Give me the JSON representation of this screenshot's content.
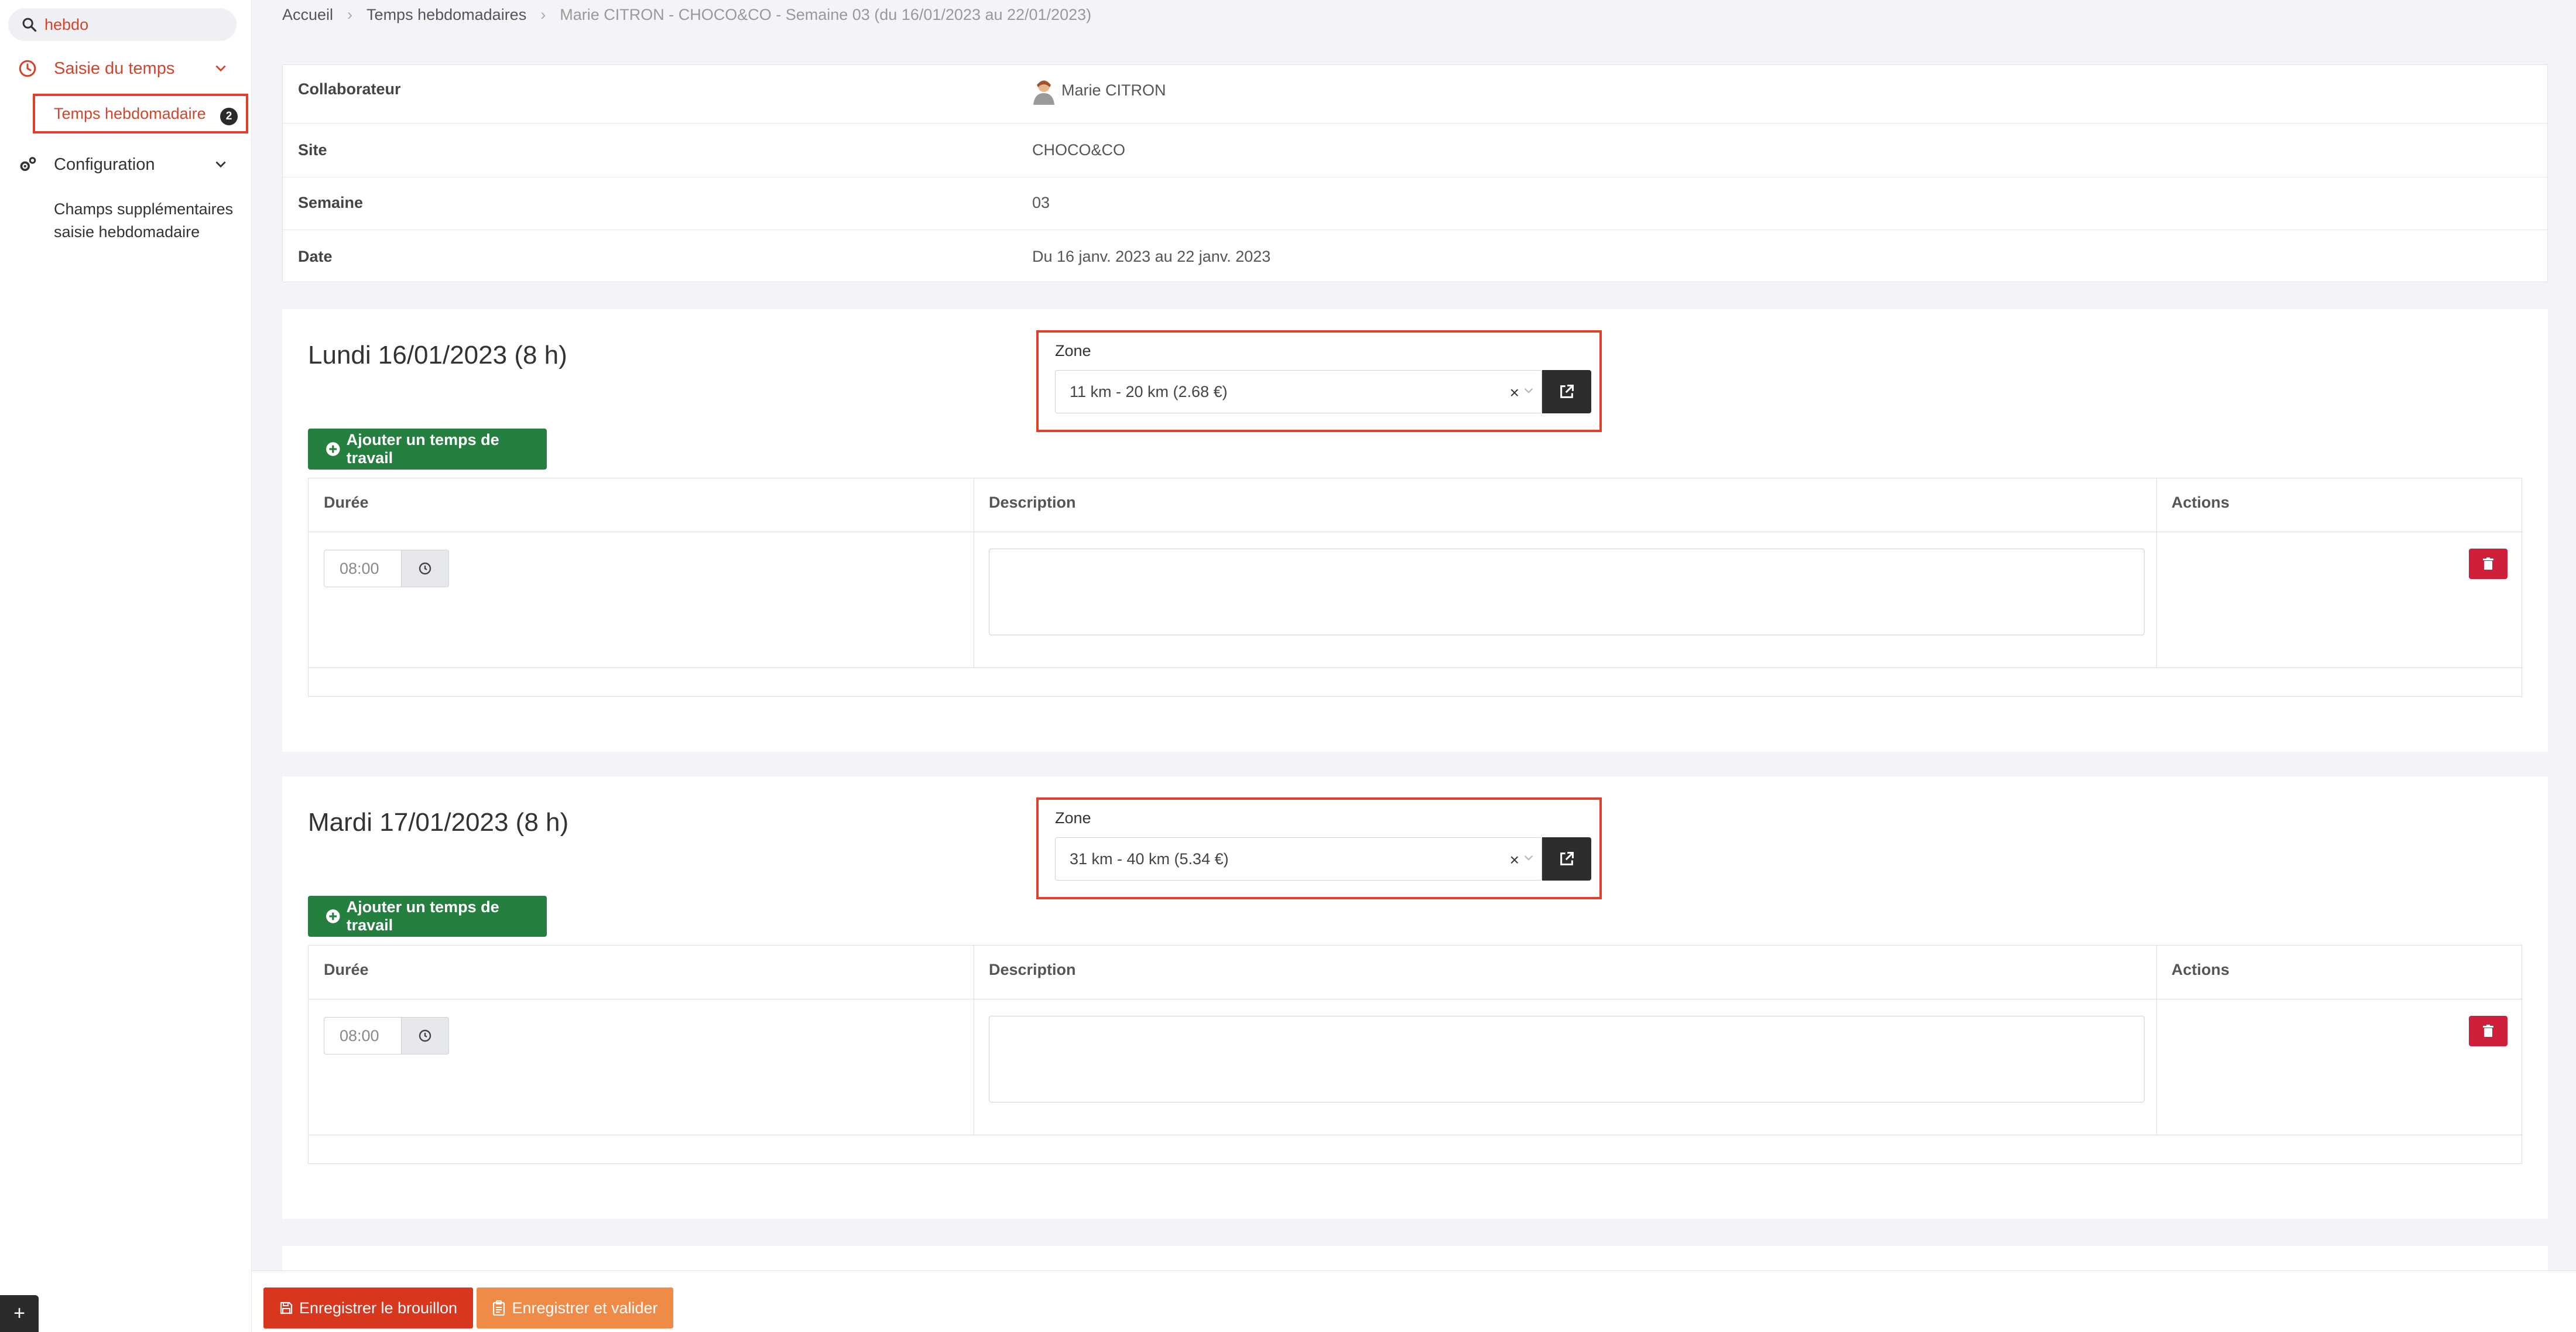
{
  "search": {
    "value": "hebdo"
  },
  "sidebar": {
    "group_time": {
      "label": "Saisie du temps"
    },
    "item_weekly": {
      "label": "Temps hebdomadaire",
      "badge": "2"
    },
    "group_config": {
      "label": "Configuration"
    },
    "item_extra_fields": {
      "label": "Champs supplémentaires saisie hebdomadaire"
    }
  },
  "breadcrumb": {
    "items": [
      "Accueil",
      "Temps hebdomadaires",
      "Marie CITRON - CHOCO&CO - Semaine 03 (du 16/01/2023 au 22/01/2023)"
    ]
  },
  "info": {
    "rows": [
      {
        "label": "Collaborateur",
        "value": "Marie CITRON"
      },
      {
        "label": "Site",
        "value": "CHOCO&CO"
      },
      {
        "label": "Semaine",
        "value": "03"
      },
      {
        "label": "Date",
        "value": "Du 16 janv. 2023 au 22 janv. 2023"
      }
    ]
  },
  "days": [
    {
      "title": "Lundi 16/01/2023 (8 h)",
      "zone_label": "Zone",
      "zone_value": "11 km - 20 km (2.68 €)",
      "add_label": "Ajouter un temps de travail",
      "col_duration": "Durée",
      "col_description": "Description",
      "col_actions": "Actions",
      "duration": "08:00",
      "description": ""
    },
    {
      "title": "Mardi 17/01/2023 (8 h)",
      "zone_label": "Zone",
      "zone_value": "31 km - 40 km (5.34 €)",
      "add_label": "Ajouter un temps de travail",
      "col_duration": "Durée",
      "col_description": "Description",
      "col_actions": "Actions",
      "duration": "08:00",
      "description": ""
    }
  ],
  "footer": {
    "draft_label": "Enregistrer le brouillon",
    "validate_label": "Enregistrer et valider"
  },
  "colors": {
    "accent": "#d2452b",
    "highlight_border": "#e0402a",
    "add_button": "#25803f",
    "delete_button": "#d01f3b",
    "draft_button": "#d9361e",
    "validate_button": "#ef8a47"
  }
}
